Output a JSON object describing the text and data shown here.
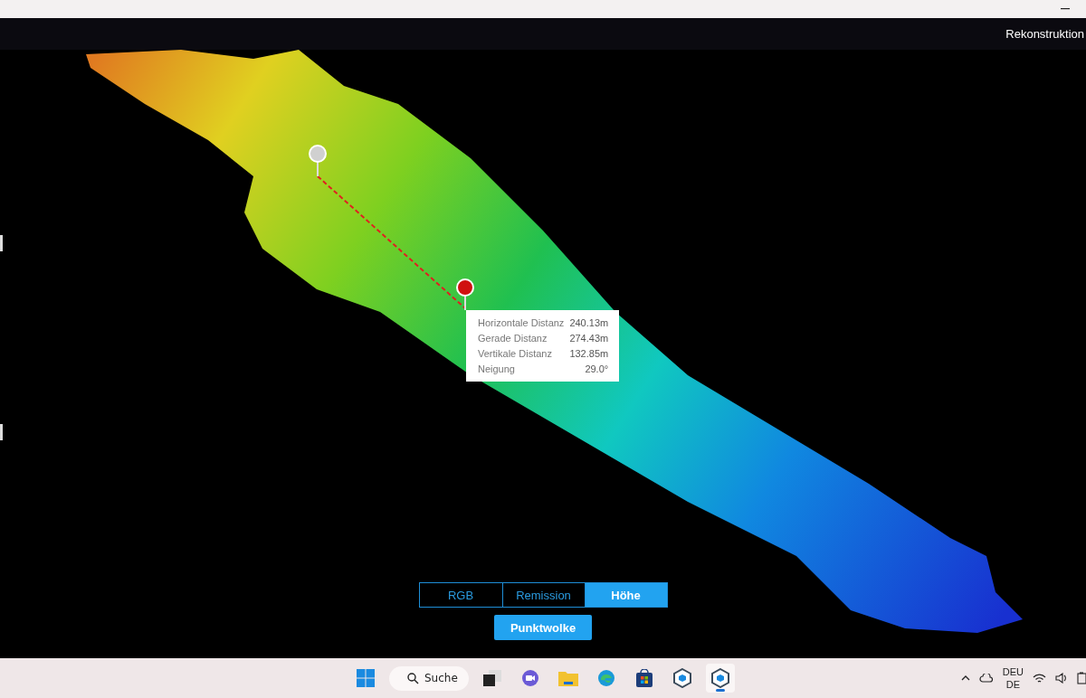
{
  "header": {
    "title": "Rekonstruktion"
  },
  "measurement": {
    "rows": [
      {
        "label": "Horizontale Distanz",
        "value": "240.13m"
      },
      {
        "label": "Gerade Distanz",
        "value": "274.43m"
      },
      {
        "label": "Vertikale Distanz",
        "value": "132.85m"
      },
      {
        "label": "Neigung",
        "value": "29.0°"
      }
    ]
  },
  "view_modes": [
    {
      "label": "RGB",
      "selected": false
    },
    {
      "label": "Remission",
      "selected": false
    },
    {
      "label": "Höhe",
      "selected": true
    }
  ],
  "primary_button": "Punktwolke",
  "taskbar": {
    "search_label": "Suche",
    "apps": [
      {
        "kind": "start",
        "selected": false
      },
      {
        "kind": "taskview",
        "selected": false
      },
      {
        "kind": "chat",
        "selected": false
      },
      {
        "kind": "explorer",
        "selected": false
      },
      {
        "kind": "edge",
        "selected": false
      },
      {
        "kind": "store",
        "selected": false
      },
      {
        "kind": "app",
        "selected": false
      },
      {
        "kind": "app",
        "selected": true
      }
    ],
    "language": [
      "DEU",
      "DE"
    ]
  }
}
